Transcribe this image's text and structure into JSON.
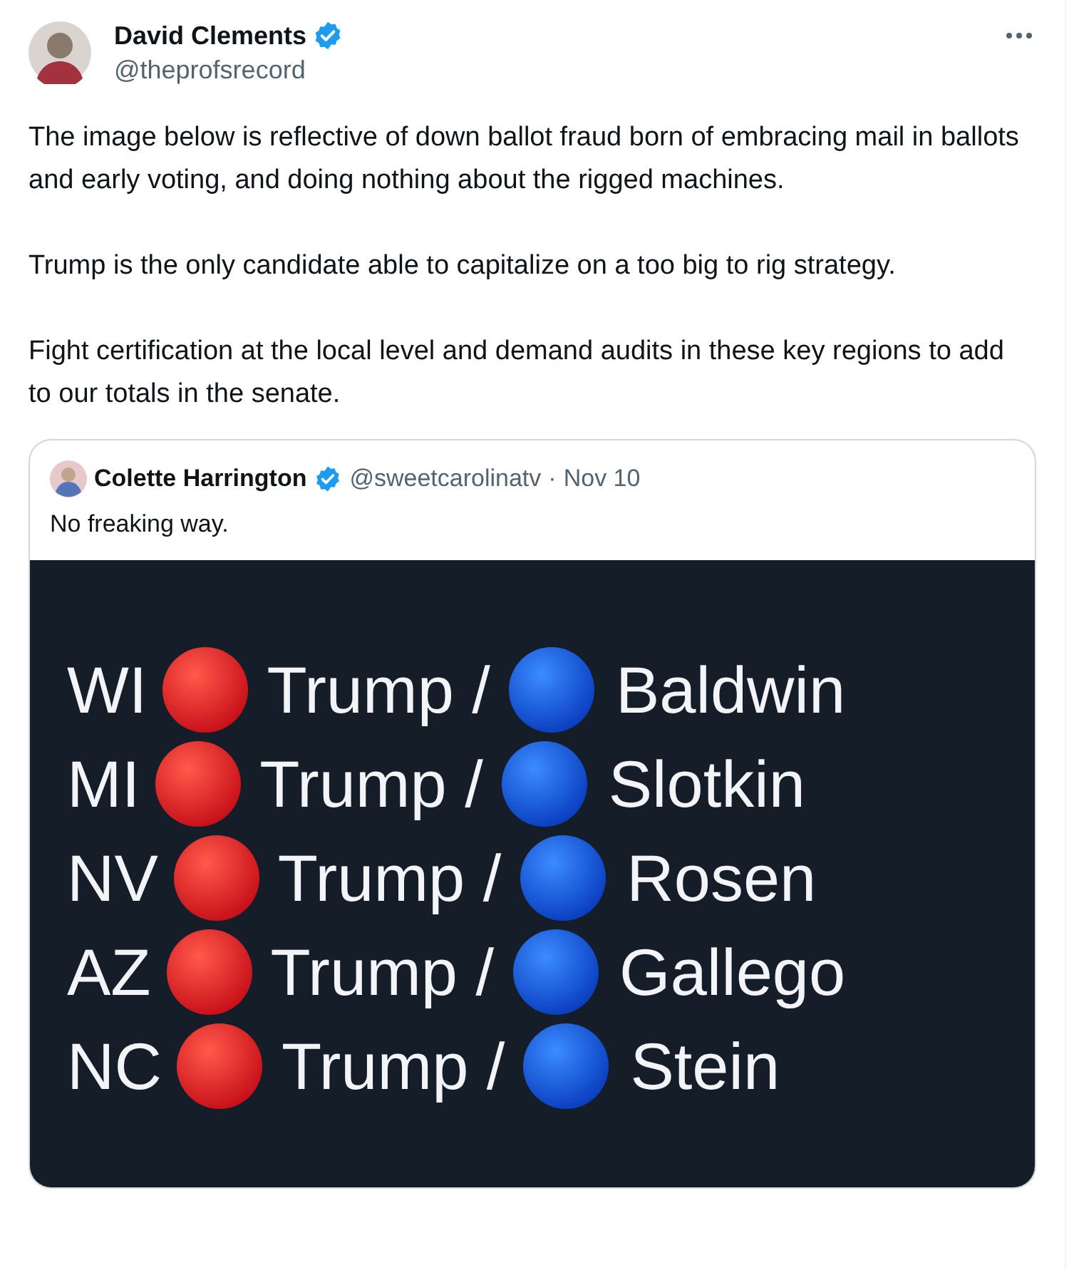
{
  "post": {
    "author": "David Clements",
    "handle": "@theprofsrecord",
    "verified": true,
    "paragraphs": [
      "The image below is reflective of down ballot fraud born of embracing mail in ballots and early voting, and doing nothing about the rigged machines.",
      "Trump is the only candidate able to capitalize on a too big to rig strategy.",
      "Fight certification at the local level and demand audits in these key regions to add to our totals in the senate."
    ]
  },
  "quote": {
    "author": "Colette Harrington",
    "verified": true,
    "handle": "@sweetcarolinatv",
    "separator": "·",
    "date": "Nov 10",
    "text": "No freaking way.",
    "image_rows": [
      {
        "state": "WI",
        "first": "Trump /",
        "second": "Baldwin"
      },
      {
        "state": "MI",
        "first": "Trump /",
        "second": "Slotkin"
      },
      {
        "state": "NV",
        "first": "Trump /",
        "second": "Rosen"
      },
      {
        "state": "AZ",
        "first": "Trump /",
        "second": "Gallego"
      },
      {
        "state": "NC",
        "first": "Trump /",
        "second": "Stein"
      }
    ]
  }
}
